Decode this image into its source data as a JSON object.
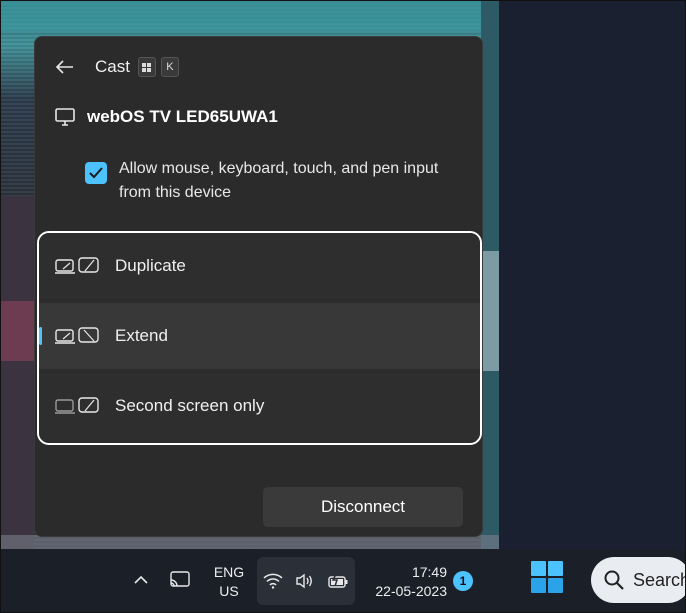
{
  "panel": {
    "title": "Cast",
    "shortcut_key": "K",
    "device_name": "webOS TV LED65UWA1",
    "allow_input_label": "Allow mouse, keyboard, touch, and pen input from this device",
    "allow_input_checked": true,
    "modes": [
      {
        "label": "Duplicate",
        "selected": false
      },
      {
        "label": "Extend",
        "selected": true
      },
      {
        "label": "Second screen only",
        "selected": false
      }
    ],
    "disconnect_label": "Disconnect"
  },
  "taskbar": {
    "lang_line1": "ENG",
    "lang_line2": "US",
    "time": "17:49",
    "date": "22-05-2023",
    "notification_count": "1",
    "search_label": "Search"
  },
  "colors": {
    "accent": "#4cc2ff",
    "panel_bg": "#2b2b2b",
    "selected_row_bg": "#383838",
    "highlight_border": "#ffffff"
  },
  "icons": [
    "back-arrow-icon",
    "windows-key-icon",
    "monitor-icon",
    "checkmark-icon",
    "duplicate-icon",
    "extend-icon",
    "second-screen-icon",
    "chevron-up-icon",
    "cast-icon",
    "wifi-icon",
    "volume-icon",
    "battery-charging-icon",
    "windows-start-icon",
    "search-icon"
  ]
}
